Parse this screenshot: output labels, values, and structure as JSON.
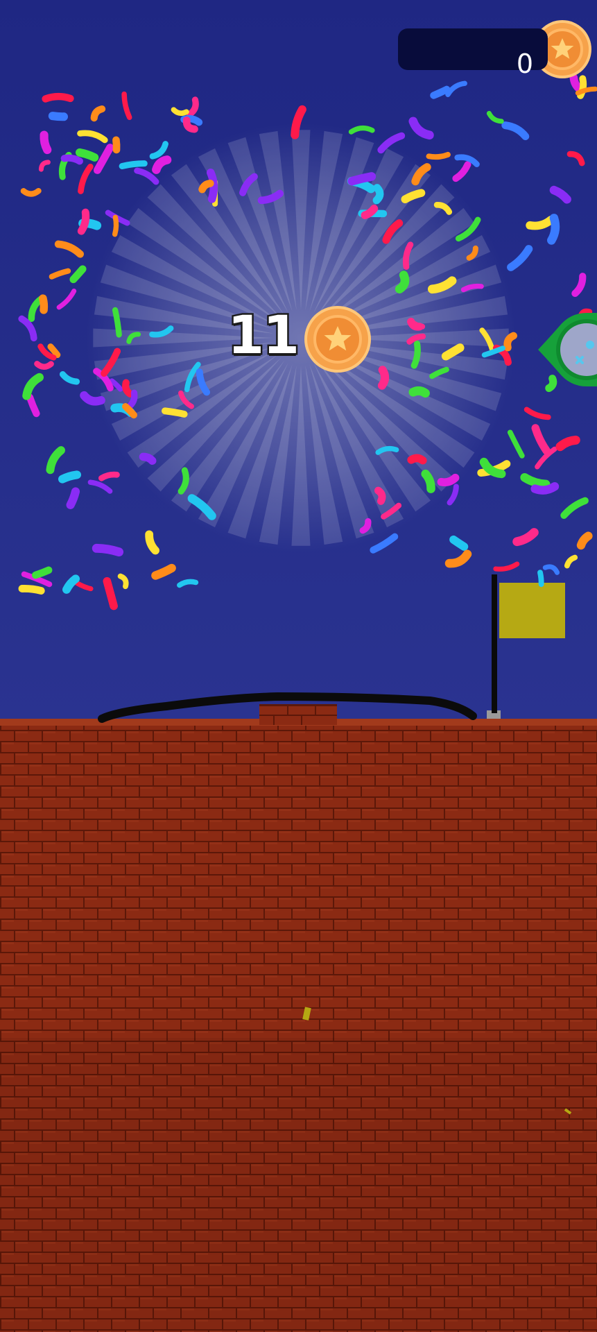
{
  "hud": {
    "coin_count": "0",
    "coin_icon": "star-coin-icon"
  },
  "reward": {
    "amount": "11",
    "coin_icon": "star-coin-icon"
  },
  "side_button": {
    "icon": "settings-gear-icon"
  },
  "colors": {
    "sky": "#26308a",
    "sky_top": "#1e2580",
    "hud_bg": "#070b3a",
    "brick": "#8a2a14",
    "mortar": "#5a1708",
    "coin_outer": "#f7a94a",
    "coin_inner": "#f59a3a",
    "star": "#ffd27a",
    "flag": "#b5a813",
    "line": "#0a0a0a",
    "side_button_ring": "#1aa13c",
    "side_button_face": "#9aa3c7"
  }
}
